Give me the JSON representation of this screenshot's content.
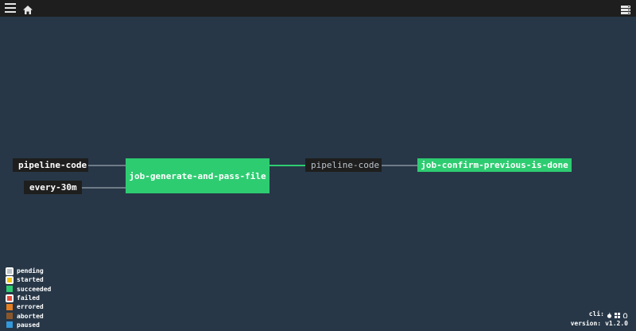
{
  "header": {
    "menu_icon": "hamburger-icon",
    "home_icon": "home-icon",
    "cli_icon": "cli-downloads-icon"
  },
  "pipeline": {
    "inputs": [
      {
        "name": "pipeline-code"
      },
      {
        "name": "every-30m"
      }
    ],
    "jobs": [
      {
        "name": "job-generate-and-pass-file",
        "status": "succeeded"
      },
      {
        "name": "job-confirm-previous-is-done",
        "status": "succeeded"
      }
    ],
    "passed_resource": {
      "name": "pipeline-code"
    }
  },
  "legend": [
    {
      "label": "pending",
      "color": "#bcc3ca",
      "ring": true
    },
    {
      "label": "started",
      "color": "#f1c40f",
      "ring": true
    },
    {
      "label": "succeeded",
      "color": "#2ecc71",
      "ring": false
    },
    {
      "label": "failed",
      "color": "#e74c3c",
      "ring": true
    },
    {
      "label": "errored",
      "color": "#e67e22",
      "ring": false
    },
    {
      "label": "aborted",
      "color": "#8b572a",
      "ring": false
    },
    {
      "label": "paused",
      "color": "#3498db",
      "ring": false
    }
  ],
  "footer": {
    "cli_label": "cli:",
    "cli_icons": [
      "apple-icon",
      "windows-icon",
      "linux-icon"
    ],
    "version_label": "version:",
    "version_value": "v1.2.0"
  },
  "colors": {
    "background": "#273747",
    "topbar": "#1e1e1e",
    "edge_default": "#6f7b87",
    "edge_active": "#2ecc71",
    "job_succeeded": "#2ecc71"
  }
}
